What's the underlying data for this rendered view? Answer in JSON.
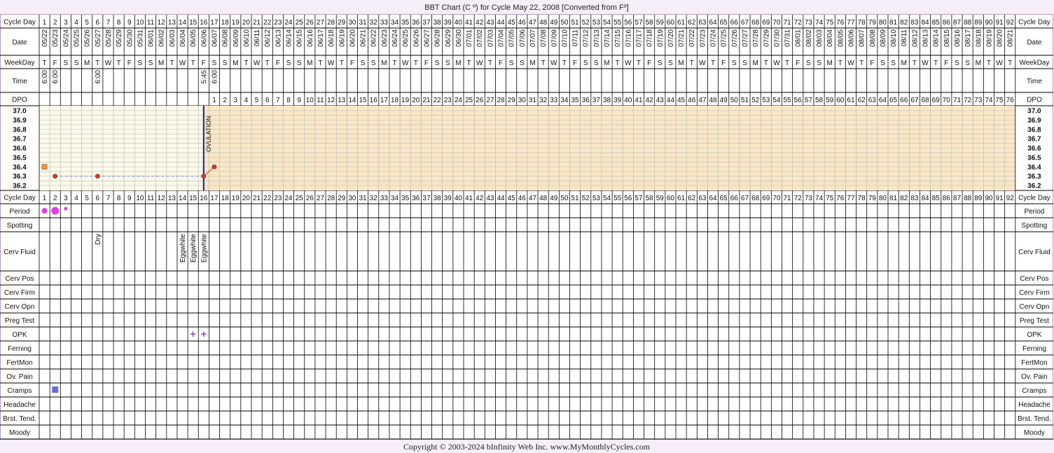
{
  "header": {
    "title": "BBT Chart (C º) for Cycle May 22, 2008  [Converted from Fº]"
  },
  "footer": {
    "copyright": "Copyright © 2003-2024 bInfinity Web Inc.     www.MyMonthlyCycles.com"
  },
  "rows": {
    "cycle_day": "Cycle Day",
    "date": "Date",
    "weekday": "WeekDay",
    "time": "Time",
    "dpo": "DPO",
    "period": "Period",
    "spotting": "Spotting",
    "cerv_fluid": "Cerv Fluid",
    "cerv_pos": "Cerv Pos",
    "cerv_firm": "Cerv Firm",
    "cerv_opn": "Cerv Opn",
    "preg_test": "Preg Test",
    "opk": "OPK",
    "ferning": "Ferning",
    "fertmon": "FertMon",
    "ov_pain": "Ov. Pain",
    "cramps": "Cramps",
    "headache": "Headache",
    "brst_tend": "Brst. Tend.",
    "moody": "Moody"
  },
  "colors": {
    "pre_ovulation_bg": "#fbfaea",
    "post_ovulation_bg": "#f9e7c6",
    "row_bg": "#ffffff",
    "label_bg": "#ffffff",
    "outer_bg": "#f6eef8",
    "border": "#b49bc1",
    "grid_line": "#000000",
    "chart_grid": "#b9b9b9",
    "ovulation_line": "#1c1c9c",
    "temp_line": "#d23b2c",
    "temp_point": "#d23b2c",
    "dashed_line": "#7a7ae0",
    "period_dot": "#e23ee8",
    "opk_mark": "#9b52c2",
    "cramps_mark": "#6a6ad8",
    "open_marker": "#f0954c"
  },
  "chart_data": {
    "type": "line",
    "title": "BBT Chart (C º) for Cycle May 22, 2008  [Converted from Fº]",
    "cycle_days": [
      1,
      2,
      3,
      4,
      5,
      6,
      7,
      8,
      9,
      10,
      11,
      12,
      13,
      14,
      15,
      16,
      17,
      18,
      19,
      20,
      21,
      22,
      23,
      24,
      25,
      26,
      27,
      28,
      29,
      30,
      31,
      32,
      33,
      34,
      35,
      36,
      37,
      38,
      39,
      40,
      41,
      42,
      43,
      44,
      45,
      46,
      47,
      48,
      49,
      50,
      51,
      52,
      53,
      54,
      55,
      56,
      57,
      58,
      59,
      60,
      61,
      62,
      63,
      64,
      65,
      66,
      67,
      68,
      69,
      70,
      71,
      72,
      73,
      74,
      75,
      76,
      77,
      78,
      79,
      80,
      81,
      82,
      83,
      84,
      85,
      86,
      87,
      88,
      89,
      90,
      91,
      92
    ],
    "dates": [
      "05/22",
      "05/23",
      "05/24",
      "05/25",
      "05/26",
      "05/27",
      "05/28",
      "05/29",
      "05/30",
      "05/31",
      "06/01",
      "06/02",
      "06/03",
      "06/04",
      "06/05",
      "06/06",
      "06/07",
      "06/08",
      "06/09",
      "06/10",
      "06/11",
      "06/12",
      "06/13",
      "06/14",
      "06/15",
      "06/16",
      "06/17",
      "06/18",
      "06/19",
      "06/20",
      "06/21",
      "06/22",
      "06/23",
      "06/24",
      "06/25",
      "06/26",
      "06/27",
      "06/28",
      "06/29",
      "06/30",
      "07/01",
      "07/02",
      "07/03",
      "07/04",
      "07/05",
      "07/06",
      "07/07",
      "07/08",
      "07/09",
      "07/10",
      "07/11",
      "07/12",
      "07/13",
      "07/14",
      "07/15",
      "07/16",
      "07/17",
      "07/18",
      "07/19",
      "07/20",
      "07/21",
      "07/22",
      "07/23",
      "07/24",
      "07/25",
      "07/26",
      "07/27",
      "07/28",
      "07/29",
      "07/30",
      "07/31",
      "08/01",
      "08/02",
      "08/03",
      "08/04",
      "08/05",
      "08/06",
      "08/07",
      "08/08",
      "08/09",
      "08/10",
      "08/11",
      "08/12",
      "08/13",
      "08/14",
      "08/15",
      "08/16",
      "08/17",
      "08/18",
      "08/19",
      "08/20",
      "08/21"
    ],
    "weekdays": [
      "T",
      "F",
      "S",
      "S",
      "M",
      "T",
      "W",
      "T",
      "F",
      "S",
      "S",
      "M",
      "T",
      "W",
      "T",
      "F",
      "S",
      "S",
      "M",
      "T",
      "W",
      "T",
      "F",
      "S",
      "S",
      "M",
      "T",
      "W",
      "T",
      "F",
      "S",
      "S",
      "M",
      "T",
      "W",
      "T",
      "F",
      "S",
      "S",
      "M",
      "T",
      "W",
      "T",
      "F",
      "S",
      "S",
      "M",
      "T",
      "W",
      "T",
      "F",
      "S",
      "S",
      "M",
      "T",
      "W",
      "T",
      "F",
      "S",
      "S",
      "M",
      "T",
      "W",
      "T",
      "F",
      "S",
      "S",
      "M",
      "T",
      "W",
      "T",
      "F",
      "S",
      "S",
      "M",
      "T",
      "W",
      "T",
      "F",
      "S",
      "S",
      "M",
      "T",
      "W",
      "T",
      "F",
      "S",
      "S",
      "M",
      "T",
      "W",
      "T"
    ],
    "times": {
      "1": "6:00",
      "2": "6:00",
      "6": "6:00",
      "16": "5:45",
      "17": "6:00"
    },
    "dpo": {
      "start_cycle_day": 17,
      "values": [
        1,
        2,
        3,
        4,
        5,
        6,
        7,
        8,
        9,
        10,
        11,
        12,
        13,
        14,
        15,
        16,
        17,
        18,
        19,
        20,
        21,
        22,
        23,
        24,
        25,
        26,
        27,
        28,
        29,
        30,
        31,
        32,
        33,
        34,
        35,
        36,
        37,
        38,
        39,
        40,
        41,
        42,
        43,
        44,
        45,
        46,
        47,
        48,
        49,
        50,
        51,
        52,
        53,
        54,
        55,
        56,
        57,
        58,
        59,
        60,
        61,
        62,
        63,
        64,
        65,
        66,
        67,
        68,
        69,
        70,
        71,
        72,
        73,
        74,
        75,
        76
      ]
    },
    "y_ticks": [
      "37.0",
      "36.9",
      "36.8",
      "36.7",
      "36.6",
      "36.5",
      "36.4",
      "36.3",
      "36.2"
    ],
    "ylim": [
      36.2,
      37.0
    ],
    "temperatures": [
      {
        "cycle_day": 2,
        "value": 36.3
      },
      {
        "cycle_day": 6,
        "value": 36.3
      },
      {
        "cycle_day": 16,
        "value": 36.3
      },
      {
        "cycle_day": 17,
        "value": 36.4
      }
    ],
    "open_marker": {
      "cycle_day": 1,
      "value": 36.4
    },
    "ovulation": {
      "cycle_day": 16,
      "label": "OVULATION"
    },
    "period": [
      {
        "cycle_day": 1,
        "size": "medium"
      },
      {
        "cycle_day": 2,
        "size": "heavy"
      },
      {
        "cycle_day": 3,
        "size": "light"
      }
    ],
    "cerv_fluid": [
      {
        "cycle_day": 6,
        "label": "Dry"
      },
      {
        "cycle_day": 14,
        "label": "Eggwhite"
      },
      {
        "cycle_day": 15,
        "label": "Eggwhite"
      },
      {
        "cycle_day": 16,
        "label": "Eggwhite"
      }
    ],
    "opk": [
      {
        "cycle_day": 15,
        "mark": "+"
      },
      {
        "cycle_day": 16,
        "mark": "+"
      }
    ],
    "cramps": [
      {
        "cycle_day": 2
      }
    ]
  }
}
